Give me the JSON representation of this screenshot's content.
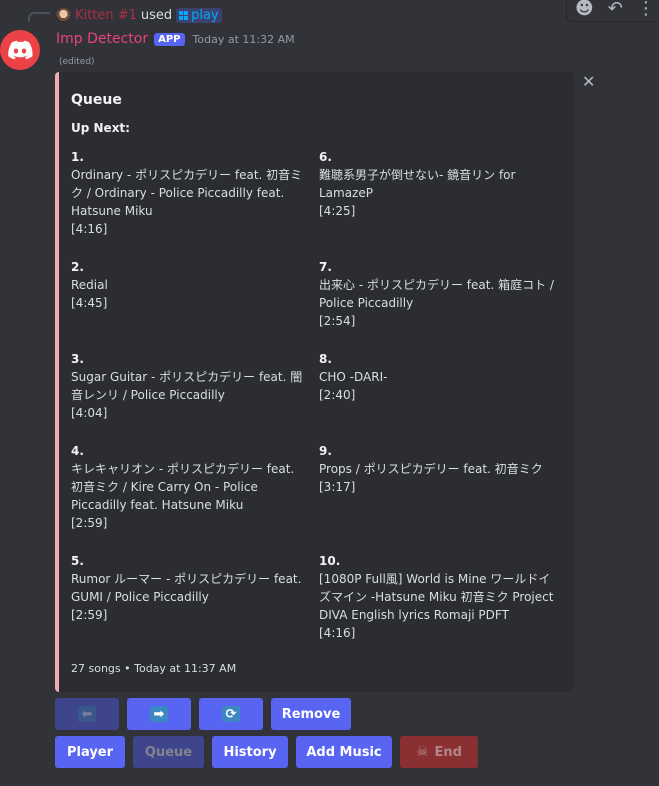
{
  "reply": {
    "user": "Kitten #1",
    "used": "used",
    "command": "play"
  },
  "message": {
    "author": "Imp Detector",
    "tag": "APP",
    "timestamp": "Today at 11:32 AM",
    "edited": "(edited)"
  },
  "embed": {
    "accent_color": "#f4aab4",
    "title": "Queue",
    "field_name": "Up Next:",
    "songs": [
      {
        "num": "1.",
        "title": "Ordinary - ポリスピカデリー feat. 初音ミク / Ordinary - Police Piccadilly feat. Hatsune Miku",
        "duration": "[4:16]"
      },
      {
        "num": "2.",
        "title": "Redial",
        "duration": "[4:45]"
      },
      {
        "num": "3.",
        "title": "Sugar Guitar - ポリスピカデリー feat. 闇音レンリ / Police Piccadilly",
        "duration": "[4:04]"
      },
      {
        "num": "4.",
        "title": "キレキャリオン - ポリスピカデリー feat. 初音ミク / Kire Carry On - Police Piccadilly feat. Hatsune Miku",
        "duration": "[2:59]"
      },
      {
        "num": "5.",
        "title": "Rumor ルーマー - ポリスピカデリー feat. GUMI / Police Piccadilly",
        "duration": "[2:59]"
      },
      {
        "num": "6.",
        "title": "難聴系男子が倒せない- 鏡音リン for LamazeP",
        "duration": "[4:25]"
      },
      {
        "num": "7.",
        "title": "出来心 - ポリスピカデリー feat. 箱庭コト / Police Piccadilly",
        "duration": "[2:54]"
      },
      {
        "num": "8.",
        "title": "CHO -DARI-",
        "duration": "[2:40]"
      },
      {
        "num": "9.",
        "title": "Props / ポリスピカデリー feat. 初音ミク",
        "duration": "[3:17]"
      },
      {
        "num": "10.",
        "title": "[1080P Full風] World is Mine ワールドイズマイン -Hatsune Miku 初音ミク Project DIVA English lyrics Romaji PDFT",
        "duration": "[4:16]"
      }
    ],
    "footer": "27 songs • Today at 11:37 AM"
  },
  "buttons": {
    "prev_icon": "arrow-left-icon",
    "next_icon": "arrow-right-icon",
    "loop_icon": "repeat-icon",
    "remove": "Remove",
    "player": "Player",
    "queue": "Queue",
    "history": "History",
    "add_music": "Add Music",
    "end": "End",
    "end_icon": "skull-icon"
  }
}
